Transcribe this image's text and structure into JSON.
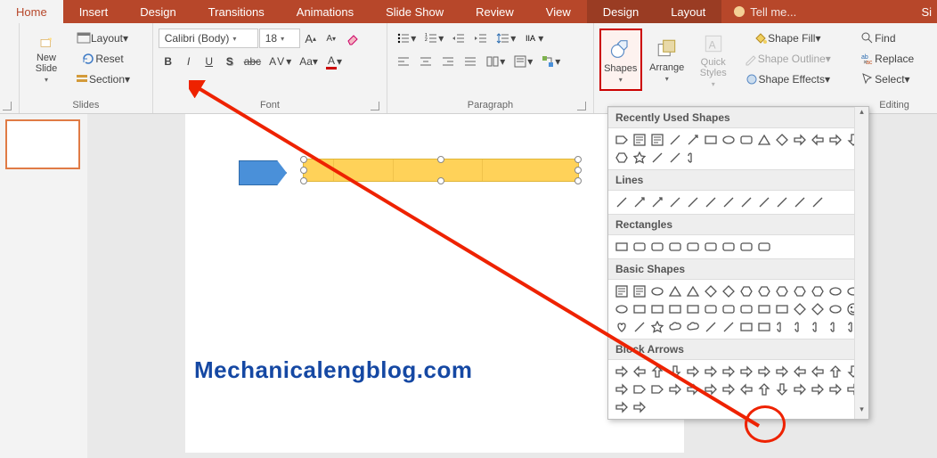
{
  "tabs": {
    "home": "Home",
    "insert": "Insert",
    "design": "Design",
    "transitions": "Transitions",
    "animations": "Animations",
    "slideshow": "Slide Show",
    "review": "Review",
    "view": "View",
    "fmt_design": "Design",
    "fmt_layout": "Layout",
    "tellme": "Tell me...",
    "signin": "Si"
  },
  "slides_group": {
    "label": "Slides",
    "new_slide": "New\nSlide",
    "layout": "Layout",
    "reset": "Reset",
    "section": "Section"
  },
  "font_group": {
    "label": "Font",
    "font_name": "Calibri (Body)",
    "font_size": "18"
  },
  "paragraph_group": {
    "label": "Paragraph"
  },
  "drawing_group": {
    "shapes": "Shapes",
    "arrange": "Arrange",
    "quick": "Quick\nStyles",
    "fill": "Shape Fill",
    "outline": "Shape Outline",
    "effects": "Shape Effects"
  },
  "editing_group": {
    "label": "Editing",
    "find": "Find",
    "replace": "Replace",
    "select": "Select"
  },
  "gallery": {
    "recent": "Recently Used Shapes",
    "lines": "Lines",
    "rects": "Rectangles",
    "basic": "Basic Shapes",
    "block": "Block Arrows"
  },
  "watermark": "Mechanicalengblog.com"
}
